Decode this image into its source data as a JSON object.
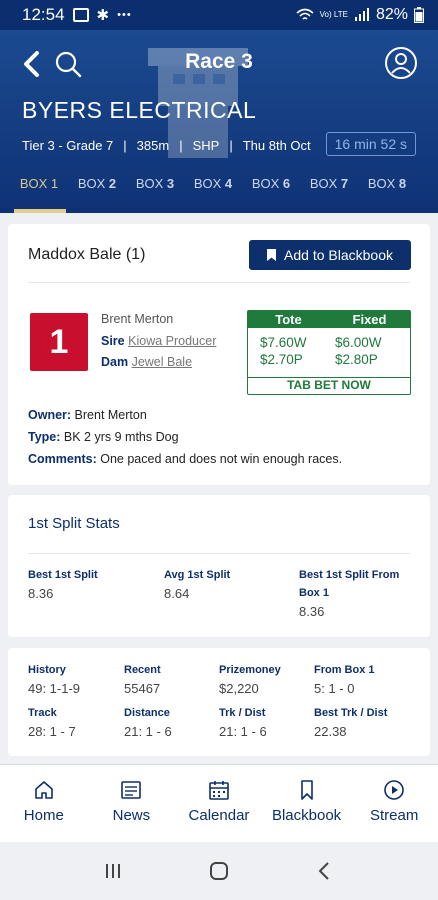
{
  "status_bar": {
    "time": "12:54",
    "battery": "82%",
    "signal_text": "Vo) LTE"
  },
  "header": {
    "race_title": "Race 3",
    "venue": "BYERS ELECTRICAL",
    "meta": [
      "Tier 3 - Grade 7",
      "385m",
      "SHP",
      "Thu 8th Oct"
    ],
    "countdown": "16 min 52 s",
    "tabs": [
      {
        "prefix": "BOX ",
        "num": "1"
      },
      {
        "prefix": "BOX ",
        "num": "2"
      },
      {
        "prefix": "BOX ",
        "num": "3"
      },
      {
        "prefix": "BOX ",
        "num": "4"
      },
      {
        "prefix": "BOX ",
        "num": "6"
      },
      {
        "prefix": "BOX ",
        "num": "7"
      },
      {
        "prefix": "BOX ",
        "num": "8"
      }
    ]
  },
  "runner": {
    "name": "Maddox Bale (1)",
    "blackbook_label": "Add to Blackbook",
    "box": "1",
    "trainer": "Brent Merton",
    "sire_label": "Sire",
    "sire": "Kiowa Producer",
    "dam_label": "Dam",
    "dam": "Jewel Bale",
    "odds": {
      "tote_label": "Tote",
      "fixed_label": "Fixed",
      "tote_win": "$7.60W",
      "tote_place": "$2.70P",
      "fixed_win": "$6.00W",
      "fixed_place": "$2.80P",
      "tab_bet": "TAB BET NOW"
    },
    "owner_label": "Owner:",
    "owner": "Brent Merton",
    "type_label": "Type:",
    "type": "BK 2 yrs 9 mths Dog",
    "comments_label": "Comments:",
    "comments": "One paced and does not win enough races."
  },
  "split_stats": {
    "title": "1st Split Stats",
    "items": [
      {
        "label": "Best 1st Split",
        "value": "8.36"
      },
      {
        "label": "Avg 1st Split",
        "value": "8.64"
      },
      {
        "label": "Best 1st Split From",
        "label2": "Box 1",
        "value": "8.36"
      }
    ]
  },
  "form_stats": [
    {
      "label": "History",
      "value": "49: 1-1-9"
    },
    {
      "label": "Recent",
      "value": "55467"
    },
    {
      "label": "Prizemoney",
      "value": "$2,220"
    },
    {
      "label": "From Box 1",
      "value": "5: 1 - 0"
    },
    {
      "label": "Track",
      "value": "28: 1 - 7"
    },
    {
      "label": "Distance",
      "value": "21: 1 - 6"
    },
    {
      "label": "Trk / Dist",
      "value": "21: 1 - 6"
    },
    {
      "label": "Best Trk / Dist",
      "value": "22.38"
    }
  ],
  "bottom_nav": [
    {
      "label": "Home",
      "icon": "home-icon"
    },
    {
      "label": "News",
      "icon": "news-icon"
    },
    {
      "label": "Calendar",
      "icon": "calendar-icon"
    },
    {
      "label": "Blackbook",
      "icon": "bookmark-icon"
    },
    {
      "label": "Stream",
      "icon": "play-icon"
    }
  ]
}
